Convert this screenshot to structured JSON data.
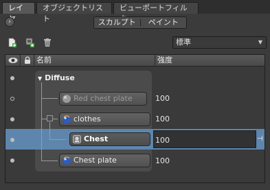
{
  "tabs": [
    {
      "label": "レイヤ",
      "active": true
    },
    {
      "label": "オブジェクトリスト",
      "active": false
    },
    {
      "label": "ビューポートフィルタ",
      "active": false
    }
  ],
  "mode": {
    "toggle_icon": "chevron-right-icon",
    "sculpt_label": "スカルプト",
    "paint_label": "ペイント"
  },
  "toolbar": {
    "icons": [
      "new-layer-icon",
      "add-layer-icon",
      "trash-icon"
    ],
    "blend_mode": "標準"
  },
  "table": {
    "headers": {
      "visibility_icon": "eye-icon",
      "lock_icon": "lock-icon",
      "name": "名前",
      "strength": "強度"
    },
    "group": {
      "name": "Diffuse",
      "expanded": true
    },
    "layers": [
      {
        "name": "Red chest plate",
        "strength": "100",
        "visible": false,
        "dimmed": true,
        "icon": "sphere-icon-gray"
      },
      {
        "name": "clothes",
        "strength": "100",
        "visible": true,
        "dimmed": false,
        "icon": "sphere-icon-blue"
      },
      {
        "name": "Chest",
        "strength": "100",
        "visible": true,
        "selected": true,
        "icon": "mask-icon"
      },
      {
        "name": "Chest plate",
        "strength": "100",
        "visible": true,
        "dimmed": false,
        "icon": "sphere-icon-blue"
      }
    ]
  },
  "colors": {
    "selection": "#5e86ad",
    "background": "#3b3b3b"
  }
}
